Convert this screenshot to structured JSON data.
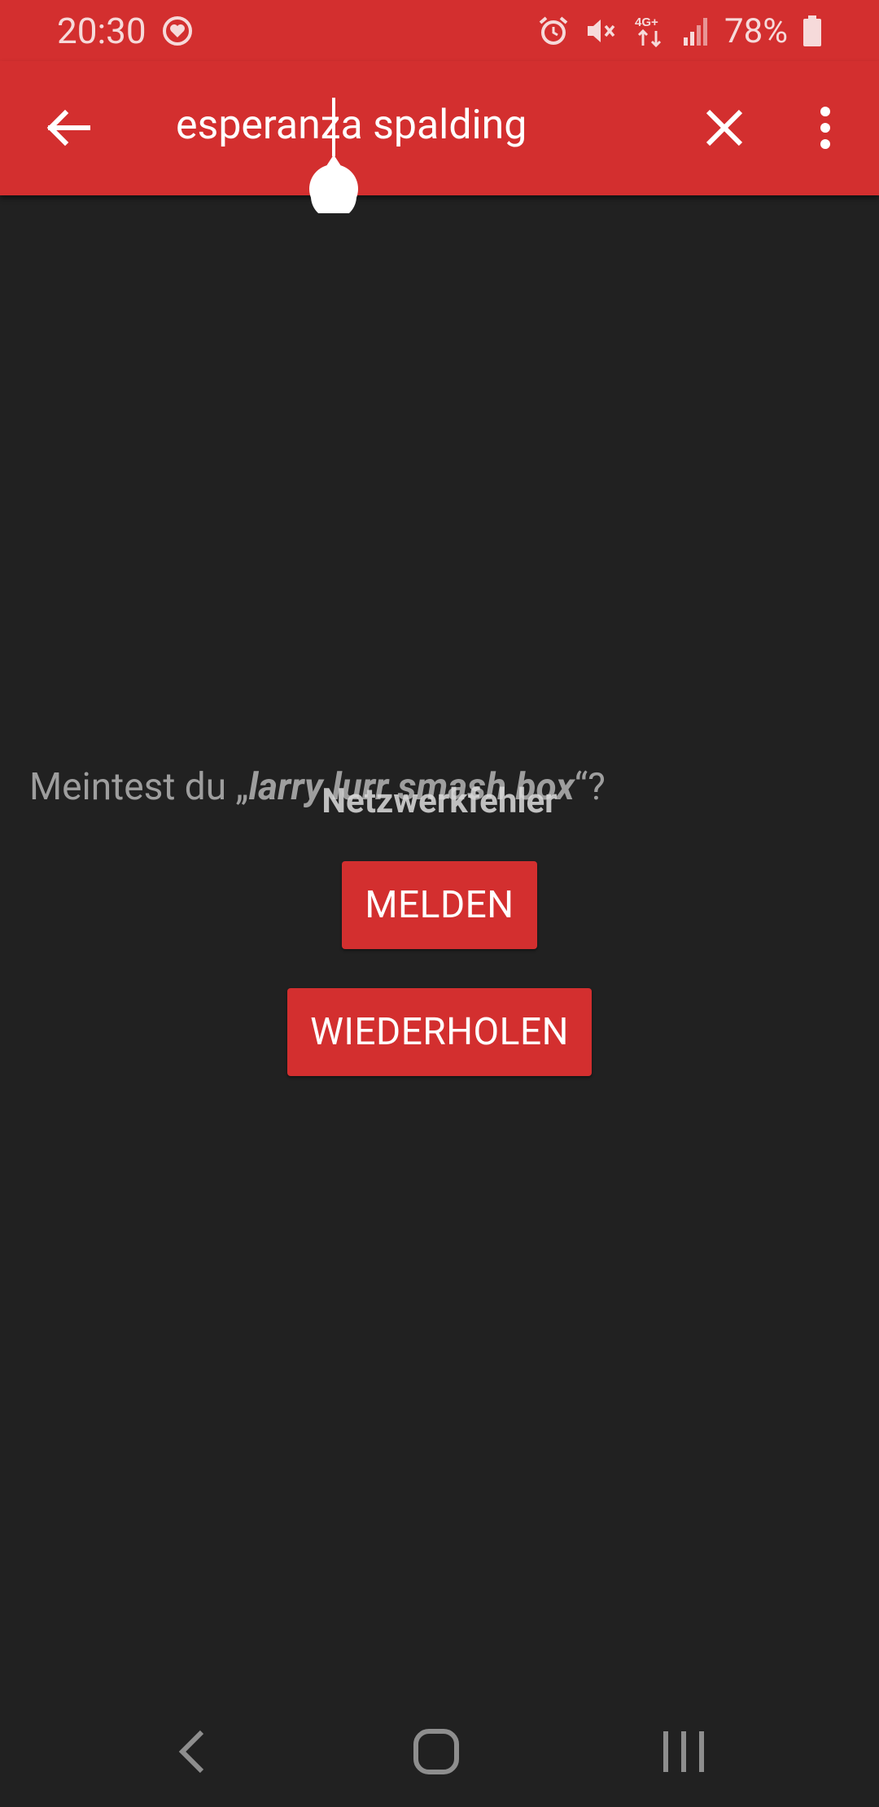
{
  "status_bar": {
    "time": "20:30",
    "battery": "78%",
    "icons": [
      "heart-circle-icon",
      "alarm-icon",
      "mute-icon",
      "4g-data-icon",
      "signal-icon",
      "battery-icon"
    ]
  },
  "search": {
    "query": "esperanza spalding",
    "back_icon": "arrow-back-icon",
    "clear_icon": "close-icon",
    "more_icon": "more-vert-icon"
  },
  "content": {
    "did_you_mean_prefix": "Meintest du „",
    "did_you_mean_suggestion": "larry lurr smash box",
    "did_you_mean_suffix": "“?",
    "error_title": "Netzwerkfehler",
    "report_button": "MELDEN",
    "retry_button": "WIEDERHOLEN"
  },
  "colors": {
    "accent": "#d32f2f",
    "background": "#212121"
  },
  "nav_bar": {
    "icons": [
      "nav-back-icon",
      "nav-home-icon",
      "nav-recents-icon"
    ]
  }
}
